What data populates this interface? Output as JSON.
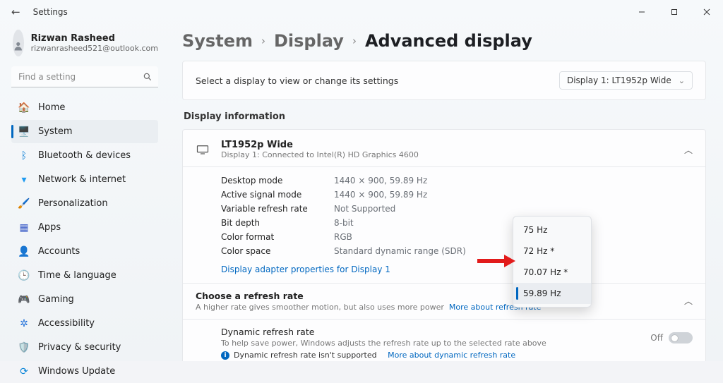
{
  "titlebar": {
    "app": "Settings"
  },
  "user": {
    "name": "Rizwan Rasheed",
    "email": "rizwanrasheed521@outlook.com"
  },
  "search": {
    "placeholder": "Find a setting"
  },
  "nav": {
    "home": "Home",
    "system": "System",
    "bluetooth": "Bluetooth & devices",
    "network": "Network & internet",
    "personalization": "Personalization",
    "apps": "Apps",
    "accounts": "Accounts",
    "time": "Time & language",
    "gaming": "Gaming",
    "accessibility": "Accessibility",
    "privacy": "Privacy & security",
    "update": "Windows Update"
  },
  "breadcrumb": {
    "a": "System",
    "b": "Display",
    "c": "Advanced display"
  },
  "selectRow": {
    "label": "Select a display to view or change its settings",
    "value": "Display 1: LT1952p Wide"
  },
  "sections": {
    "displayInfo": "Display information"
  },
  "device": {
    "name": "LT1952p Wide",
    "sub": "Display 1: Connected to Intel(R) HD Graphics 4600"
  },
  "kv": {
    "desktopMode_k": "Desktop mode",
    "desktopMode_v": "1440 × 900, 59.89 Hz",
    "activeSignal_k": "Active signal mode",
    "activeSignal_v": "1440 × 900, 59.89 Hz",
    "vrr_k": "Variable refresh rate",
    "vrr_v": "Not Supported",
    "bitDepth_k": "Bit depth",
    "bitDepth_v": "8-bit",
    "colorFmt_k": "Color format",
    "colorFmt_v": "RGB",
    "colorSpace_k": "Color space",
    "colorSpace_v": "Standard dynamic range (SDR)"
  },
  "adapterLink": "Display adapter properties for Display 1",
  "refresh": {
    "title": "Choose a refresh rate",
    "sub": "A higher rate gives smoother motion, but also uses more power",
    "more": "More about refresh rate"
  },
  "popup": {
    "o1": "75 Hz",
    "o2": "72 Hz *",
    "o3": "70.07 Hz *",
    "o4": "59.89 Hz"
  },
  "dynamic": {
    "title": "Dynamic refresh rate",
    "sub": "To help save power, Windows adjusts the refresh rate up to the selected rate above",
    "unsupported": "Dynamic refresh rate isn't supported",
    "more": "More about dynamic refresh rate",
    "toggle": "Off"
  }
}
